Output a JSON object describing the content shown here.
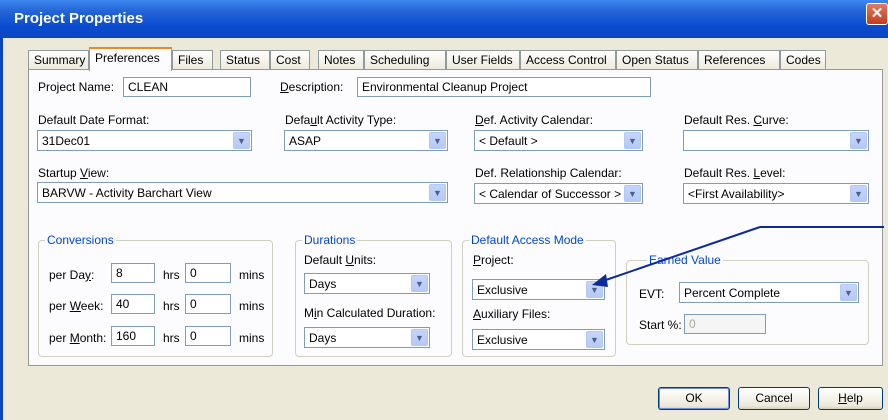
{
  "window": {
    "title": "Project Properties",
    "close_glyph": "✕"
  },
  "tabs": [
    {
      "label": "Summary"
    },
    {
      "label": "Preferences"
    },
    {
      "label": "Files"
    },
    {
      "label": "Status"
    },
    {
      "label": "Cost"
    },
    {
      "label": "Notes"
    },
    {
      "label": "Scheduling"
    },
    {
      "label": "User Fields"
    },
    {
      "label": "Access Control"
    },
    {
      "label": "Open Status"
    },
    {
      "label": "References"
    },
    {
      "label": "Codes"
    }
  ],
  "active_tab": "Preferences",
  "project": {
    "name_label": "Project Name:",
    "name_value": "CLEAN",
    "desc_label_pre": "",
    "desc_label_u": "D",
    "desc_label_post": "escription:",
    "desc_value": "Environmental Cleanup Project"
  },
  "defaults": {
    "date_format_label": "Default Date Format:",
    "date_format_value": "31Dec01",
    "activity_type_label_pre": "Defa",
    "activity_type_label_u": "u",
    "activity_type_label_post": "lt Activity Type:",
    "activity_type_value": "ASAP",
    "activity_calendar_label_pre": "",
    "activity_calendar_label_u": "D",
    "activity_calendar_label_post": "ef. Activity Calendar:",
    "activity_calendar_value": "< Default >",
    "res_curve_label_pre": "Default Res. ",
    "res_curve_label_u": "C",
    "res_curve_label_post": "urve:",
    "res_curve_value": "",
    "startup_view_label_pre": "Startup ",
    "startup_view_label_u": "V",
    "startup_view_label_post": "iew:",
    "startup_view_value": "BARVW - Activity Barchart View",
    "relationship_calendar_label": "Def. Relationship Calendar:",
    "relationship_calendar_value": "< Calendar of Successor >",
    "res_level_label_pre": "Default Res. ",
    "res_level_label_u": "L",
    "res_level_label_post": "evel:",
    "res_level_value": "<First Availability>"
  },
  "conversions": {
    "title": "Conversions",
    "rows": [
      {
        "label_pre": "per Da",
        "label_u": "y",
        "label_post": ":",
        "hrs": "8",
        "mins": "0"
      },
      {
        "label_pre": "per ",
        "label_u": "W",
        "label_post": "eek:",
        "hrs": "40",
        "mins": "0"
      },
      {
        "label_pre": "per ",
        "label_u": "M",
        "label_post": "onth:",
        "hrs": "160",
        "mins": "0"
      }
    ],
    "hrs_label": "hrs",
    "mins_label": "mins"
  },
  "durations": {
    "title": "Durations",
    "units_label_pre": "Default ",
    "units_label_u": "U",
    "units_label_post": "nits:",
    "units_value": "Days",
    "min_label_pre": "M",
    "min_label_u": "i",
    "min_label_post": "n Calculated Duration:",
    "min_value": "Days"
  },
  "access_mode": {
    "title": "Default Access Mode",
    "project_label_pre": "",
    "project_label_u": "P",
    "project_label_post": "roject:",
    "project_value": "Exclusive",
    "aux_label_pre": "",
    "aux_label_u": "A",
    "aux_label_post": "uxiliary Files:",
    "aux_value": "Exclusive"
  },
  "earned_value": {
    "title": "Earned Value",
    "evt_label": "EVT:",
    "evt_value": "Percent Complete",
    "start_label": "Start %:",
    "start_value": "0"
  },
  "buttons": {
    "ok": "OK",
    "cancel": "Cancel",
    "help_u": "H",
    "help_post": "elp"
  },
  "colors": {
    "title_bar": "#0b46c0",
    "group_title": "#0046d5",
    "annotation_arrow": "#0d2a9c"
  }
}
